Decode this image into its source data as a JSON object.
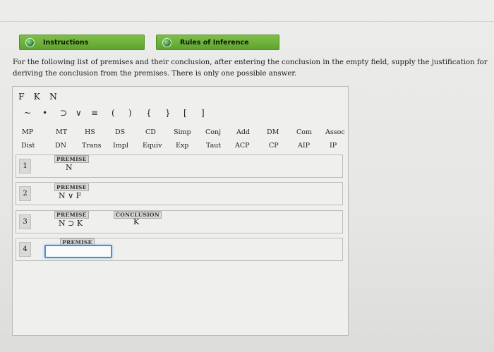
{
  "tabs": {
    "instructions": "Instructions",
    "rules": "Rules of Inference"
  },
  "intro_text": "For the following list of premises and their conclusion, after entering the conclusion in the empty field, supply the justification for deriving the conclusion from the premises. There is only one possible answer.",
  "variables": [
    "F",
    "K",
    "N"
  ],
  "symbols": [
    "~",
    "•",
    "⊃",
    "∨",
    "≡",
    "(",
    ")",
    "{",
    "}",
    "[",
    "]"
  ],
  "rules_row1": [
    "MP",
    "MT",
    "HS",
    "DS",
    "CD",
    "Simp",
    "Conj",
    "Add",
    "DM",
    "Com",
    "Assoc"
  ],
  "rules_row2": [
    "Dist",
    "DN",
    "Trans",
    "Impl",
    "Equiv",
    "Exp",
    "Taut",
    "ACP",
    "CP",
    "AIP",
    "IP"
  ],
  "lines": [
    {
      "num": "1",
      "tag": "PREMISE",
      "statement": "N"
    },
    {
      "num": "2",
      "tag": "PREMISE",
      "statement": "N ∨ F"
    },
    {
      "num": "3",
      "tag": "PREMISE",
      "statement": "N ⊃ K",
      "conclusion_tag": "CONCLUSION",
      "conclusion": "K"
    },
    {
      "num": "4",
      "tag": "PREMISE",
      "statement": ""
    }
  ],
  "colors": {
    "accent_green": "#5ea42e",
    "focus_blue": "#4b8fd8"
  }
}
